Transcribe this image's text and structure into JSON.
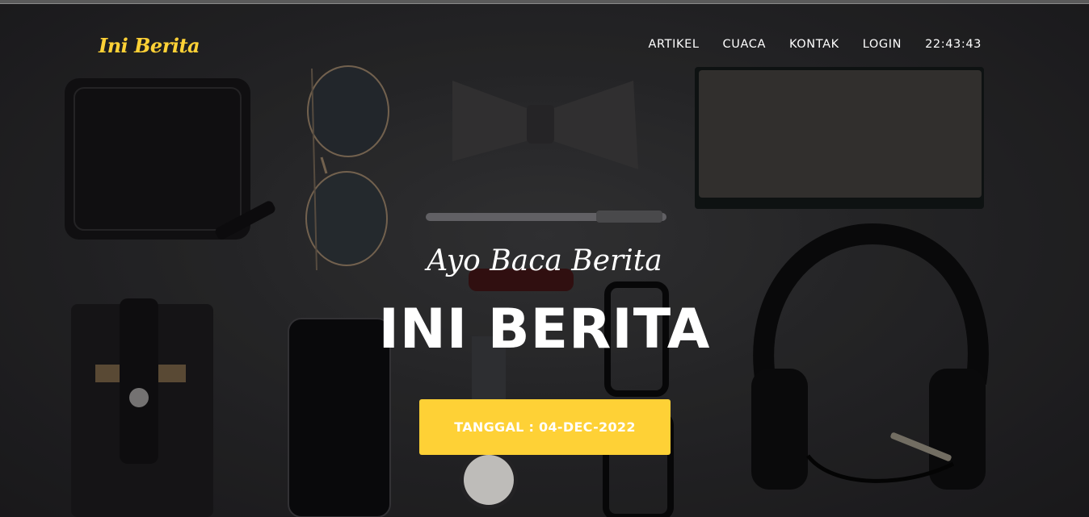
{
  "brand": {
    "name": "Ini Berita"
  },
  "nav": {
    "items": [
      {
        "label": "ARTIKEL"
      },
      {
        "label": "CUACA"
      },
      {
        "label": "KONTAK"
      },
      {
        "label": "LOGIN"
      }
    ],
    "clock": "22:43:43"
  },
  "hero": {
    "subtitle": "Ayo Baca Berita",
    "title": "INI BERITA",
    "date_button": "TANGGAL : 04-DEC-2022"
  },
  "colors": {
    "accent": "#fed136",
    "text": "#ffffff",
    "background": "#2c2c2e"
  }
}
